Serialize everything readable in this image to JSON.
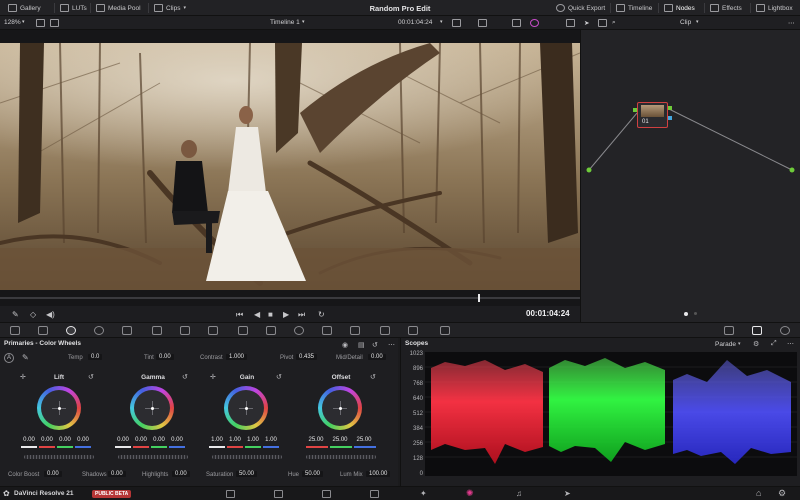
{
  "topbar": {
    "items": [
      {
        "label": "Gallery",
        "icon": "gallery-icon"
      },
      {
        "label": "LUTs",
        "icon": "luts-icon"
      },
      {
        "label": "Media Pool",
        "icon": "media-pool-icon"
      },
      {
        "label": "Clips",
        "icon": "clips-icon"
      }
    ],
    "project_title": "Random Pro Edit",
    "right_items": [
      {
        "label": "Quick Export",
        "icon": "export-icon"
      },
      {
        "label": "Timeline",
        "icon": "timeline-icon"
      },
      {
        "label": "Nodes",
        "icon": "nodes-icon"
      },
      {
        "label": "Effects",
        "icon": "effects-icon"
      },
      {
        "label": "Lightbox",
        "icon": "lightbox-icon"
      }
    ]
  },
  "subbar": {
    "zoom": "128%",
    "timeline_name": "Timeline 1",
    "timecode": "00:01:04:24",
    "node_mode": "Clip"
  },
  "nodes": {
    "node_label": "01"
  },
  "transport": {
    "timecode": "00:01:04:24"
  },
  "primaries": {
    "title": "Primaries - Color Wheels",
    "params_top": [
      {
        "label": "Temp",
        "value": "0.0"
      },
      {
        "label": "Tint",
        "value": "0.00"
      },
      {
        "label": "Contrast",
        "value": "1.000"
      },
      {
        "label": "Pivot",
        "value": "0.435"
      },
      {
        "label": "Mid/Detail",
        "value": "0.00"
      }
    ],
    "wheels": [
      {
        "name": "Lift",
        "values": [
          "0.00",
          "0.00",
          "0.00",
          "0.00"
        ]
      },
      {
        "name": "Gamma",
        "values": [
          "0.00",
          "0.00",
          "0.00",
          "0.00"
        ]
      },
      {
        "name": "Gain",
        "values": [
          "1.00",
          "1.00",
          "1.00",
          "1.00"
        ]
      },
      {
        "name": "Offset",
        "values": [
          "25.00",
          "25.00",
          "25.00"
        ]
      }
    ],
    "params_bottom": [
      {
        "label": "Color Boost",
        "value": "0.00"
      },
      {
        "label": "Shadows",
        "value": "0.00"
      },
      {
        "label": "Highlights",
        "value": "0.00"
      },
      {
        "label": "Saturation",
        "value": "50.00"
      },
      {
        "label": "Hue",
        "value": "50.00"
      },
      {
        "label": "Lum Mix",
        "value": "100.00"
      }
    ]
  },
  "scopes": {
    "title": "Scopes",
    "mode": "Parade",
    "scale": [
      "1023",
      "896",
      "768",
      "640",
      "512",
      "384",
      "256",
      "128",
      "0"
    ]
  },
  "bottombar": {
    "brand": "DaVinci Resolve 21",
    "badge": "PUBLIC BETA"
  },
  "colors": {
    "accent_red": "#e04444",
    "parade_red": "#ff3b4a",
    "parade_green": "#3bff4a",
    "parade_blue": "#5a5aff",
    "node_border": "#d04040"
  }
}
